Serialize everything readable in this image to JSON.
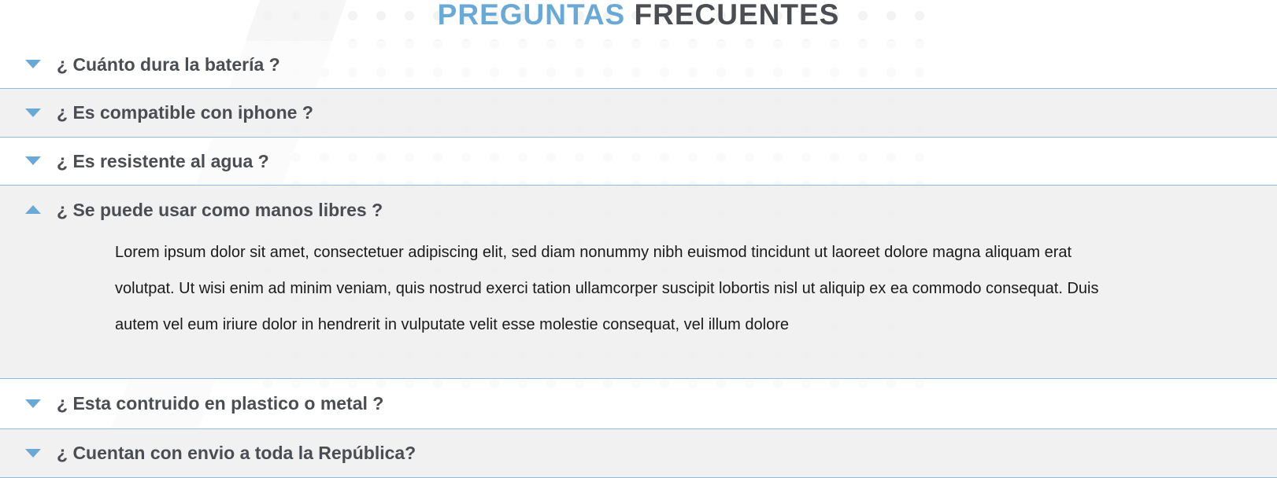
{
  "heading": {
    "word_accent": "PREGUNTAS",
    "word_main": "FRECUENTES"
  },
  "colors": {
    "accent": "#6aa9d6",
    "heading_dark": "#4a4d52",
    "divider": "#8fbde0",
    "shaded_row": "#f0f0f0"
  },
  "faq": {
    "items": [
      {
        "question": "¿ Cuánto dura la batería ?",
        "icon": "caret-down-icon",
        "expanded": false
      },
      {
        "question": "¿ Es compatible con iphone ?",
        "icon": "caret-down-icon",
        "expanded": false
      },
      {
        "question": "¿ Es resistente al agua ?",
        "icon": "caret-down-icon",
        "expanded": false
      },
      {
        "question": "¿ Se puede usar como manos libres ?",
        "icon": "caret-up-icon",
        "expanded": true,
        "answer": "Lorem ipsum dolor sit amet, consectetuer adipiscing elit, sed diam nonummy nibh euismod tincidunt ut laoreet dolore magna aliquam erat volutpat. Ut wisi enim ad minim veniam, quis nostrud exerci tation ullamcorper suscipit lobortis nisl ut aliquip ex ea commodo consequat. Duis autem vel eum iriure dolor in hendrerit in vulputate velit esse molestie consequat, vel illum dolore"
      },
      {
        "question": "¿ Esta contruido en plastico o metal ?",
        "icon": "caret-down-icon",
        "expanded": false
      },
      {
        "question": "¿ Cuentan con envio a toda la República?",
        "icon": "caret-down-icon",
        "expanded": false
      }
    ]
  }
}
